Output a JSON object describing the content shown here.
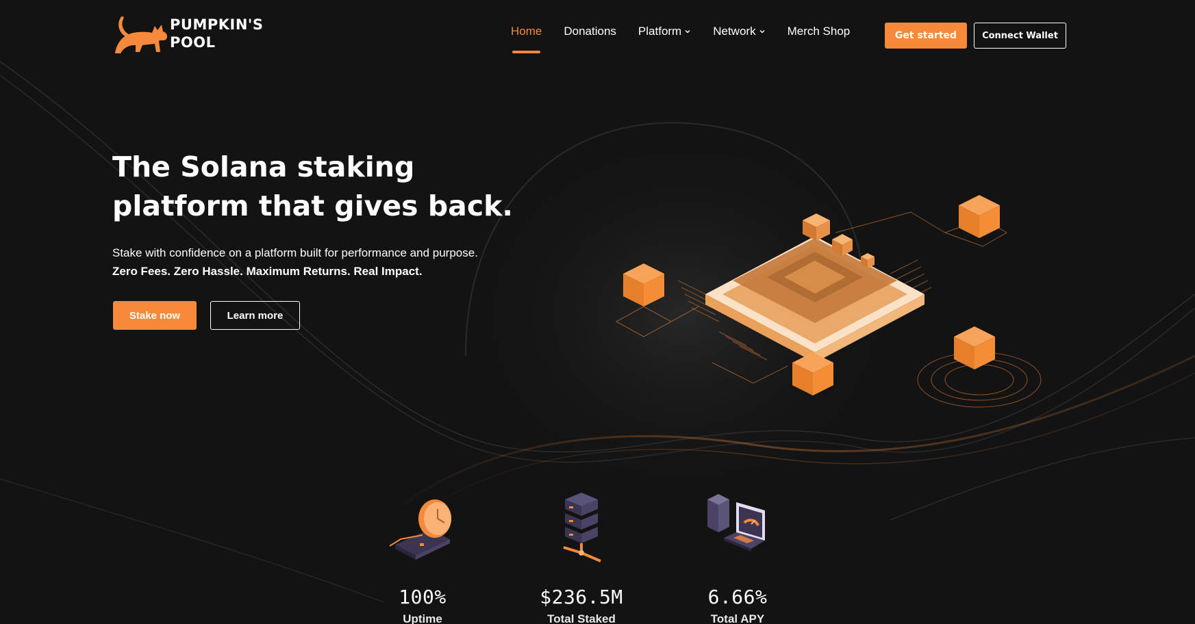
{
  "brand": {
    "name_line1": "PUMPKIN'S",
    "name_line2": "POOL",
    "accent_color": "#f7893a",
    "logo_icon": "cat-icon"
  },
  "nav": {
    "items": [
      {
        "label": "Home",
        "active": true,
        "dropdown": false
      },
      {
        "label": "Donations",
        "active": false,
        "dropdown": false
      },
      {
        "label": "Platform",
        "active": false,
        "dropdown": true
      },
      {
        "label": "Network",
        "active": false,
        "dropdown": true
      },
      {
        "label": "Merch Shop",
        "active": false,
        "dropdown": false
      }
    ],
    "get_started_label": "Get started",
    "connect_wallet_label": "Connect Wallet"
  },
  "hero": {
    "title_line1": "The Solana staking",
    "title_line2": "platform that gives back.",
    "subtitle": "Stake with confidence on a platform built for performance and purpose.",
    "tagline": "Zero Fees. Zero Hassle. Maximum Returns. Real Impact.",
    "primary_button": "Stake now",
    "secondary_button": "Learn more",
    "illustration_icon": "chip-blocks-illustration"
  },
  "stats": [
    {
      "value": "100%",
      "label": "Uptime",
      "icon": "clock-wallet-icon"
    },
    {
      "value": "$236.5M",
      "label": "Total Staked",
      "icon": "server-stack-icon"
    },
    {
      "value": "6.66%",
      "label": "Total APY",
      "icon": "laptop-gauge-icon"
    }
  ]
}
